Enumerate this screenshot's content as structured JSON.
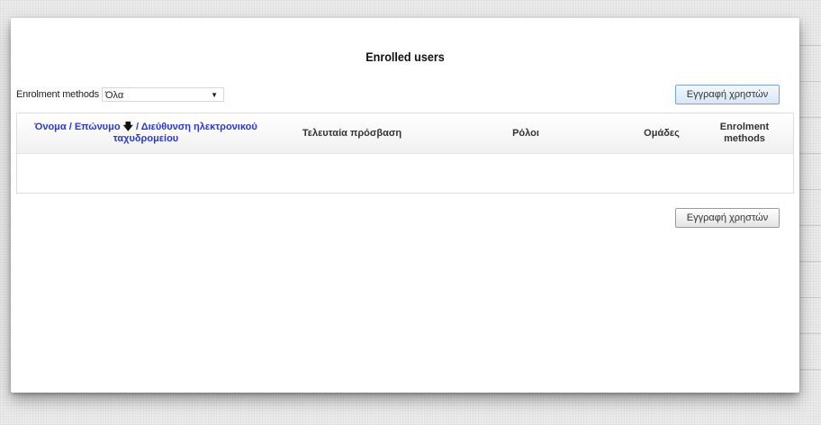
{
  "page": {
    "title": "Enrolled users"
  },
  "filter": {
    "label": "Enrolment methods",
    "selected": "Όλα",
    "caret_icon": "chevron-down-icon"
  },
  "buttons": {
    "enrol_top": "Εγγραφή χρηστών",
    "enrol_bottom": "Εγγραφή χρηστών"
  },
  "table": {
    "columns": {
      "name": "Όνομα / Επώνυμο",
      "name_sort_icon": "arrow-down-icon",
      "email": "/ Διεύθυνση ηλεκτρονικού ταχυδρομείου",
      "last_access": "Τελευταία πρόσβαση",
      "roles": "Ρόλοι",
      "groups": "Ομάδες",
      "enrolment_methods": "Enrolment methods"
    },
    "rows": []
  },
  "colors": {
    "link": "#2b39c9",
    "primary_button_top": "#f4f9ff",
    "primary_button_bottom": "#d6e6f6"
  }
}
